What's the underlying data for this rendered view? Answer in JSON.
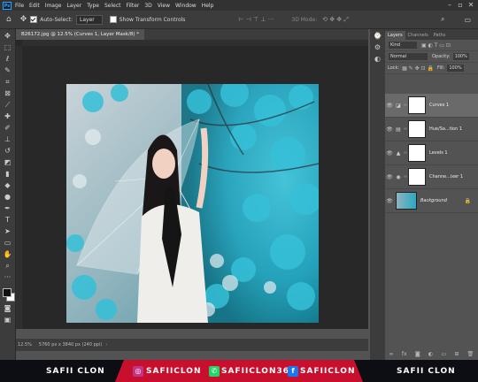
{
  "menubar": {
    "logo": "Ps",
    "items": [
      "File",
      "Edit",
      "Image",
      "Layer",
      "Type",
      "Select",
      "Filter",
      "3D",
      "View",
      "Window",
      "Help"
    ]
  },
  "options": {
    "auto_select": "Auto-Select:",
    "layer_select": "Layer",
    "show_transform": "Show Transform Controls",
    "mode_3d": "3D Mode:"
  },
  "document": {
    "tab": "B26172.jpg @ 12.5% (Curves 1, Layer Mask/8) *",
    "zoom": "12.5%",
    "size": "5760 px x 3840 px (240 ppi)"
  },
  "panel": {
    "tabs": [
      "Layers",
      "Channels",
      "Paths"
    ],
    "kind": "Kind",
    "blend": "Normal",
    "opacity_label": "Opacity:",
    "opacity": "100%",
    "lock_label": "Lock:",
    "fill_label": "Fill:",
    "fill": "100%",
    "layers": [
      {
        "name": "Curves 1",
        "selected": true
      },
      {
        "name": "Hue/Sa...tion 1",
        "selected": false
      },
      {
        "name": "Levels 1",
        "selected": false
      },
      {
        "name": "Channe...ixer 1",
        "selected": false
      },
      {
        "name": "Background",
        "selected": false
      }
    ]
  },
  "banner": {
    "left_name": "SAFII CLON",
    "instagram": "SAFIICLON",
    "whatsapp": "SAFIICLON36",
    "facebook": "SAFIICLON",
    "right_name": "SAFII CLON"
  },
  "colors": {
    "accent": "#31a8ff",
    "banner_red": "#c8102e",
    "leaves": "#29b6cf"
  }
}
